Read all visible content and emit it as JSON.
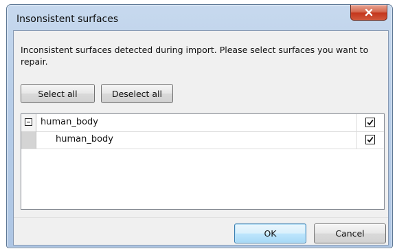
{
  "dialog": {
    "title": "Insonsistent surfaces",
    "close_icon": "close-icon",
    "message": "Inconsistent surfaces detected during import. Please select surfaces you want to repair."
  },
  "toolbar": {
    "select_all_label": "Select all",
    "deselect_all_label": "Deselect all"
  },
  "tree": {
    "rows": [
      {
        "label": "human_body",
        "level": 0,
        "expanded": true,
        "checked": true,
        "expander_icon": "collapse-minus-icon"
      },
      {
        "label": "human_body",
        "level": 1,
        "checked": true
      }
    ]
  },
  "footer": {
    "ok_label": "OK",
    "cancel_label": "Cancel"
  },
  "colors": {
    "close_button": "#c4371d",
    "default_button_border": "#3c7fb1",
    "frame": "#aec6e4"
  }
}
